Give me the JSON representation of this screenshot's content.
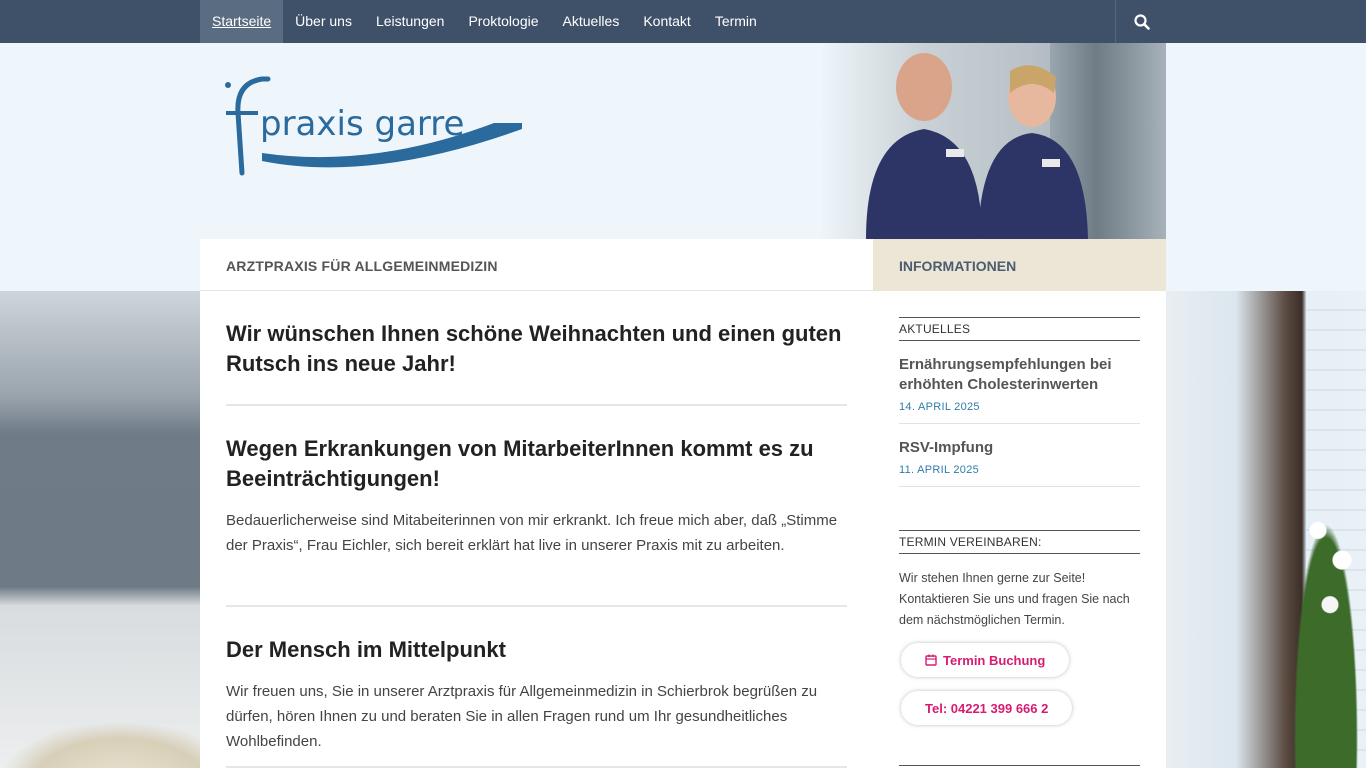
{
  "nav": {
    "items": [
      {
        "label": "Startseite",
        "active": true
      },
      {
        "label": "Über uns"
      },
      {
        "label": "Leistungen"
      },
      {
        "label": "Proktologie"
      },
      {
        "label": "Aktuelles"
      },
      {
        "label": "Kontakt"
      },
      {
        "label": "Termin"
      }
    ],
    "search_icon": "search-icon"
  },
  "header": {
    "logo_text": "praxis garre"
  },
  "titlebar": {
    "label": "ARZTPRAXIS FÜR ALLGEMEINMEDIZIN",
    "info_label": "INFORMATIONEN"
  },
  "main": {
    "articles": [
      {
        "title": "Wir wünschen Ihnen schöne Weihnachten und einen guten Rutsch ins neue Jahr!"
      },
      {
        "title": "Wegen Erkrankungen von MitarbeiterInnen kommt es zu Beeinträchtigungen!",
        "body": "Bedauerlicherweise sind Mitabeiterinnen von mir erkrankt. Ich freue mich aber, daß „Stimme der Praxis“, Frau Eichler, sich bereit erklärt hat live in unserer Praxis mit zu arbeiten."
      },
      {
        "title": "Der Mensch im Mittelpunkt",
        "body": "Wir freuen uns, Sie in unserer Arztpraxis für Allgemeinmedizin in Schierbrok begrüßen zu dürfen, hören Ihnen zu und beraten Sie in allen Fragen rund um Ihr gesundheitliches Wohlbefinden."
      }
    ]
  },
  "sidebar": {
    "news_heading": "AKTUELLES",
    "news": [
      {
        "title": "Ernährungsempfehlungen bei erhöhten Cholesterinwerten",
        "date": "14. APRIL 2025"
      },
      {
        "title": "RSV-Impfung",
        "date": "11. APRIL 2025"
      }
    ],
    "termin_heading": "TERMIN VEREINBAREN:",
    "termin_text": "Wir stehen Ihnen gerne zur Seite! Kontaktieren Sie uns und fragen Sie nach dem nächstmöglichen Termin.",
    "booking_label": "Termin Buchung",
    "phone_label": "Tel: 04221 399 666 2",
    "accent_color": "#d81b72"
  }
}
